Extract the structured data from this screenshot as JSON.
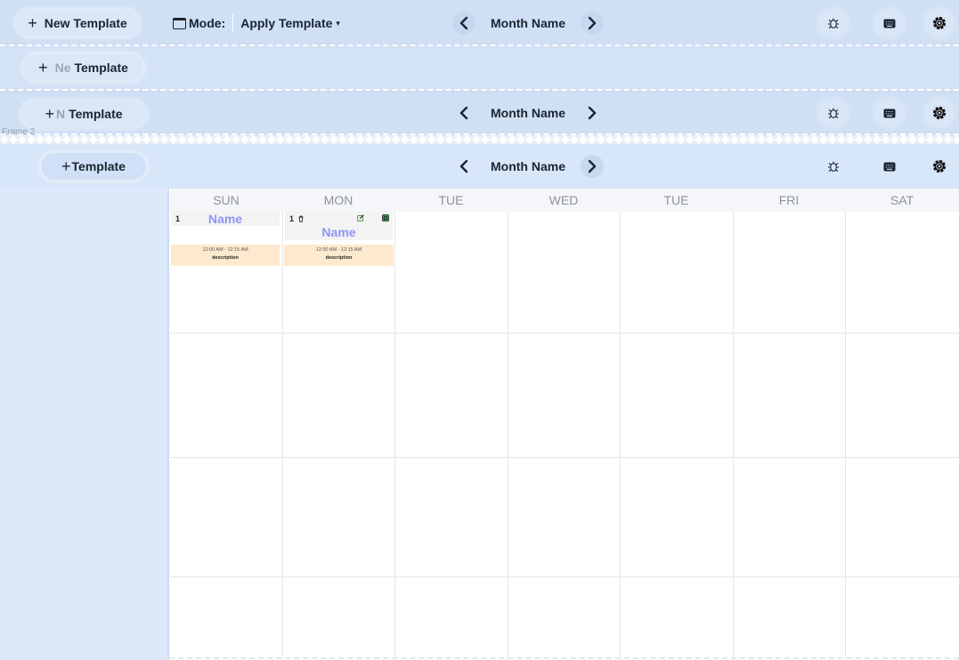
{
  "frame_label": "Frame 2",
  "toolbar1": {
    "new_template": {
      "plus": "+",
      "label": "New Template"
    },
    "mode_label": "Mode:",
    "mode_value": "Apply Template",
    "mode_caret": "▾",
    "month": "Month Name",
    "prev": "❮",
    "next": "❯"
  },
  "toolbar2": {
    "plus": "+",
    "faded": "Ne",
    "label": "Template"
  },
  "toolbar3": {
    "plus": "+",
    "faded": "N",
    "label": "Template",
    "month": "Month Name"
  },
  "toolbar4": {
    "plus": "+",
    "label": "Template",
    "month": "Month Name"
  },
  "icons": [
    "bug-icon",
    "keyboard-icon",
    "gear-icon"
  ],
  "calendar": {
    "days": [
      "SUN",
      "MON",
      "TUE",
      "WED",
      "TUE",
      "FRI",
      "SAT"
    ],
    "cells": [
      {
        "day": "1",
        "name": "Name",
        "time": "12:00 AM - 12:15 AM",
        "description": "description"
      },
      {
        "day": "1",
        "name": "Name",
        "time": "12:00 AM - 12:15 AM",
        "description": "description"
      }
    ]
  },
  "colors": {
    "toolbar": "#cfdff4",
    "sidebar": "#dbe9fb",
    "event_name": "#8d95f5",
    "event_bg": "#fde9cd",
    "edit_green": "#3a9a2e"
  }
}
